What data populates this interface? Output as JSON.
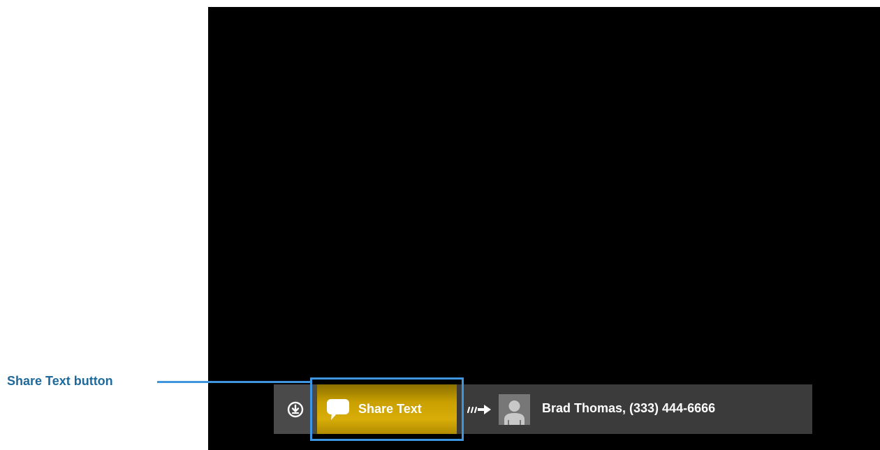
{
  "callout": {
    "label": "Share Text button",
    "color": "#1e6a9c",
    "line_color": "#3f96e0"
  },
  "toolbar": {
    "download_icon": "download-circle-icon",
    "share_button": {
      "label": "Share Text",
      "icon": "speech-bubble-icon",
      "color": "#c9a000"
    },
    "transfer_icon": "forward-arrow-icon",
    "avatar_icon": "person-silhouette-icon",
    "contact": "Brad Thomas, (333) 444-6666"
  }
}
